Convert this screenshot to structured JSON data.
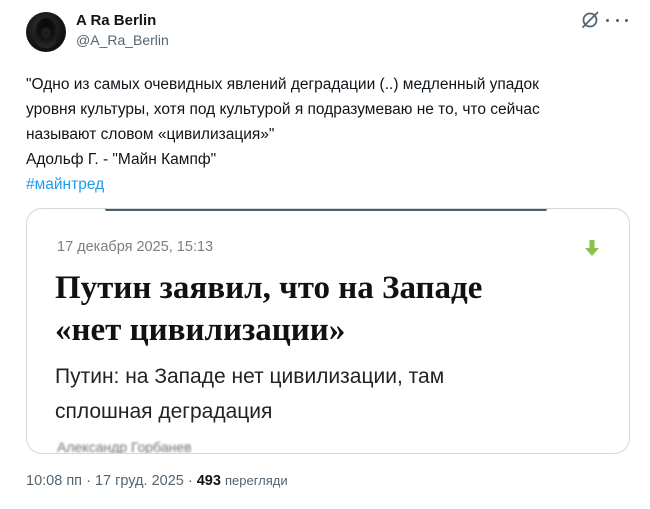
{
  "author": {
    "display_name": "A Ra Berlin",
    "handle": "@A_Ra_Berlin"
  },
  "icons": {
    "grok": "grok-icon",
    "more": "more-options-icon",
    "download": "download-arrow-icon",
    "download_color": "#8bc34a"
  },
  "tweet": {
    "lines": [
      "\"Одно из самых очевидных явлений деградации (..) медленный упадок",
      "уровня культуры, хотя под культурой я подразумеваю не то, что сейчас",
      "называют словом «цивилизация»\"",
      "Адольф Г. - \"Майн Кампф\""
    ],
    "hashtag": "#майнтред"
  },
  "card": {
    "date": "17 декабря 2025, 15:13",
    "headline_line1": "Путин заявил, что на Западе",
    "headline_line2": "«нет цивилизации»",
    "subtitle_line1": "Путин: на Западе нет цивилизации, там",
    "subtitle_line2": "сплошная деградация",
    "author_partial": "Александр Горбанев"
  },
  "meta": {
    "time": "10:08 пп",
    "separator": "·",
    "date": "17 груд. 2025",
    "views_count": "493",
    "views_label": "перегляди"
  }
}
